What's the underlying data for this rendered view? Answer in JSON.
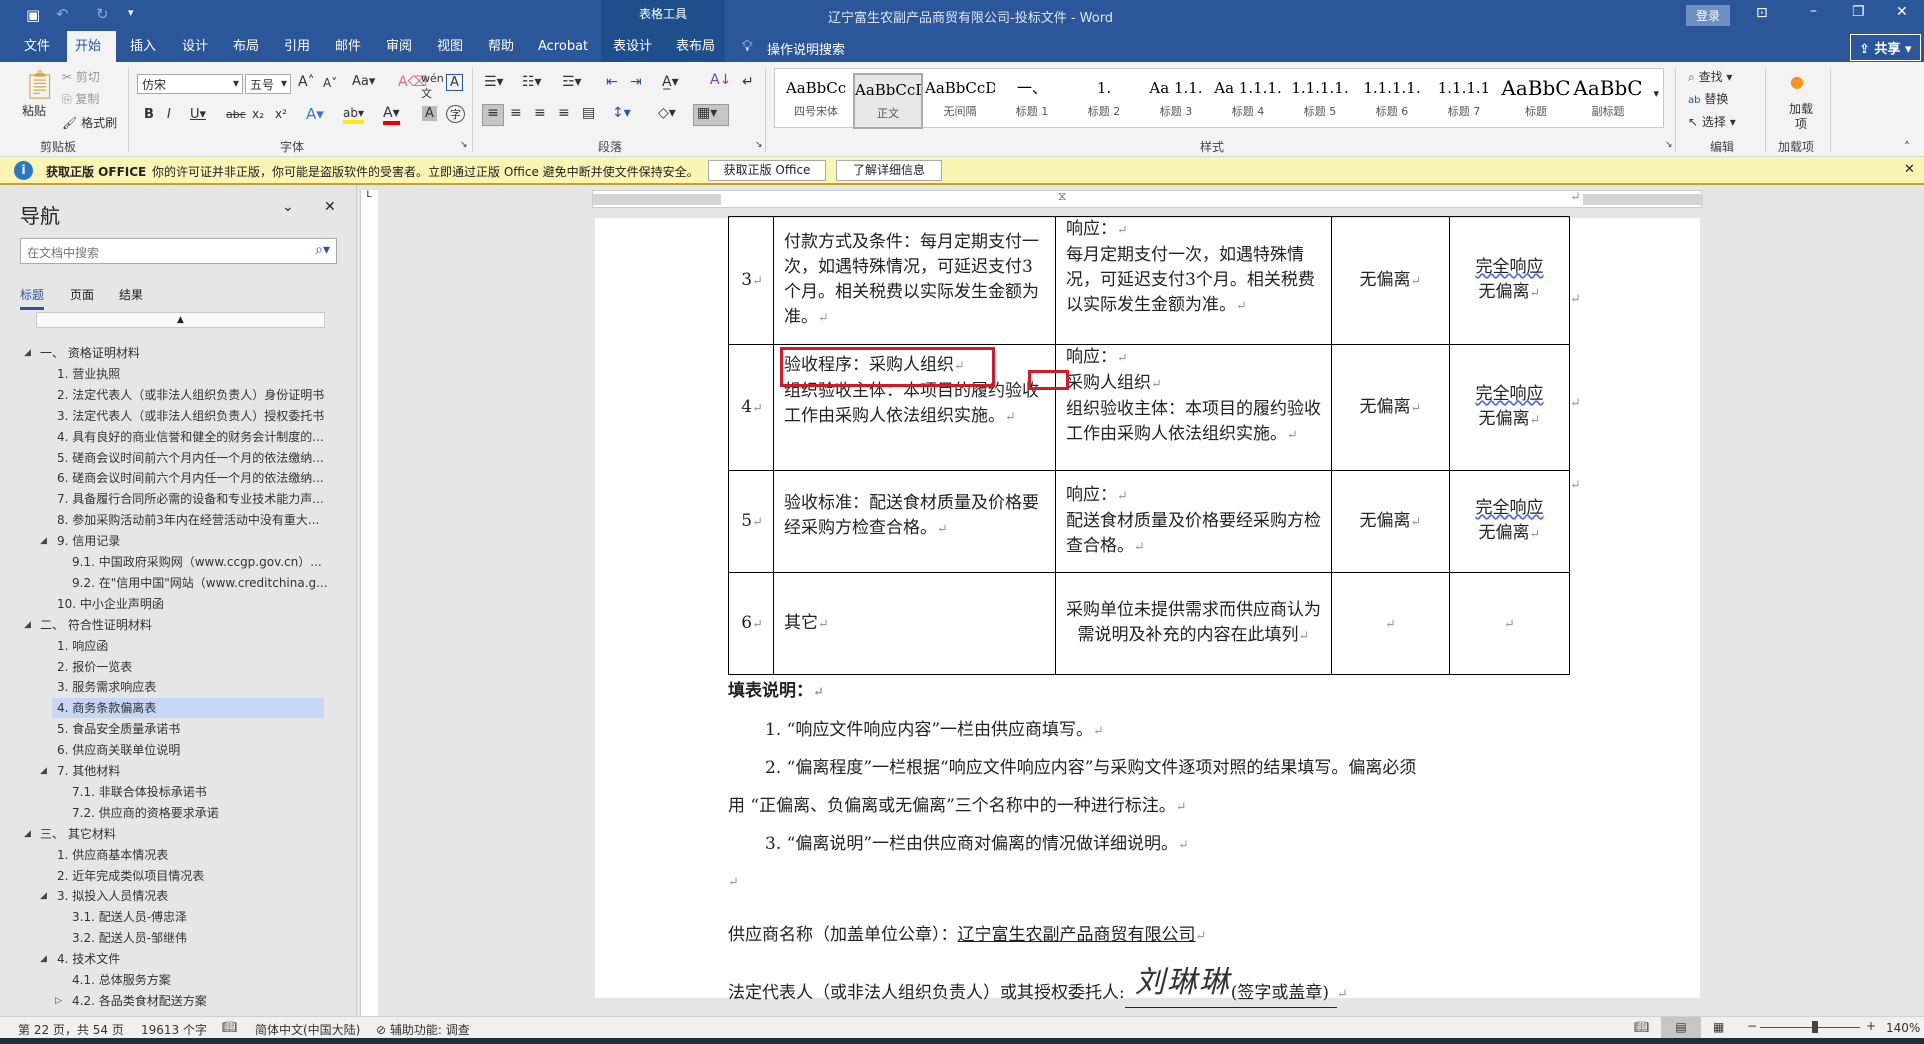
{
  "title_bar": {
    "document_title": "辽宁富生农副产品商贸有限公司-投标文件 - Word",
    "context_tab_group": "表格工具",
    "signin": "登录",
    "share": "共享"
  },
  "tabs": [
    "文件",
    "开始",
    "插入",
    "设计",
    "布局",
    "引用",
    "邮件",
    "审阅",
    "视图",
    "帮助",
    "Acrobat",
    "表设计",
    "表布局"
  ],
  "tell_me": "操作说明搜索",
  "ribbon": {
    "clipboard": {
      "paste": "粘贴",
      "cut": "剪切",
      "copy": "复制",
      "format_painter": "格式刷",
      "label": "剪贴板"
    },
    "font": {
      "font_name": "仿宋",
      "font_size": "五号",
      "label": "字体"
    },
    "paragraph": {
      "label": "段落"
    },
    "styles": {
      "label": "样式",
      "items": [
        {
          "preview": "AaBbCc",
          "name": "四号宋体"
        },
        {
          "preview": "AaBbCcDdI",
          "name": "正文"
        },
        {
          "preview": "AaBbCcDdI",
          "name": "无间隔"
        },
        {
          "preview": "一、",
          "name": "标题 1"
        },
        {
          "preview": "1.",
          "name": "标题 2"
        },
        {
          "preview": "Aa 1.1.",
          "name": "标题 3"
        },
        {
          "preview": "Aa 1.1.1.",
          "name": "标题 4"
        },
        {
          "preview": "1.1.1.1.",
          "name": "标题 5"
        },
        {
          "preview": "1.1.1.1.",
          "name": "标题 6"
        },
        {
          "preview": "1.1.1.1",
          "name": "标题 7"
        },
        {
          "preview": "AaBbC",
          "name": "标题"
        },
        {
          "preview": "AaBbC",
          "name": "副标题"
        }
      ]
    },
    "editing": {
      "find": "查找",
      "replace": "替换",
      "select": "选择",
      "label": "编辑"
    },
    "addins": {
      "button": "加载项",
      "label": "加载项"
    }
  },
  "notice": {
    "title": "获取正版 OFFICE",
    "message": "你的许可证并非正版，你可能是盗版软件的受害者。立即通过正版 Office 避免中断并使文件保持安全。",
    "btn_get": "获取正版 Office",
    "btn_learn": "了解详细信息"
  },
  "nav": {
    "title": "导航",
    "search_placeholder": "在文档中搜索",
    "tabs": [
      "标题",
      "页面",
      "结果"
    ],
    "items": [
      {
        "t": "一、  资格证明材料",
        "l": 0,
        "e": "open"
      },
      {
        "t": "1. 营业执照",
        "l": 1
      },
      {
        "t": "2. 法定代表人（或非法人组织负责人）身份证明书",
        "l": 1
      },
      {
        "t": "3. 法定代表人（或非法人组织负责人）授权委托书",
        "l": 1
      },
      {
        "t": "4. 具有良好的商业信誉和健全的财务会计制度的...",
        "l": 1
      },
      {
        "t": "5. 磋商会议时间前六个月内任一个月的依法缴纳...",
        "l": 1
      },
      {
        "t": "6. 磋商会议时间前六个月内任一个月的依法缴纳...",
        "l": 1
      },
      {
        "t": "7. 具备履行合同所必需的设备和专业技术能力声...",
        "l": 1
      },
      {
        "t": "8. 参加采购活动前3年内在经营活动中没有重大...",
        "l": 1
      },
      {
        "t": "9. 信用记录",
        "l": 1,
        "e": "open"
      },
      {
        "t": "9.1. 中国政府采购网（www.ccgp.gov.cn）...",
        "l": 2
      },
      {
        "t": "9.2. 在\"信用中国\"网站（www.creditchina.g...",
        "l": 2
      },
      {
        "t": "10. 中小企业声明函",
        "l": 1
      },
      {
        "t": "二、  符合性证明材料",
        "l": 0,
        "e": "open"
      },
      {
        "t": "1. 响应函",
        "l": 1
      },
      {
        "t": "2. 报价一览表",
        "l": 1
      },
      {
        "t": "3. 服务需求响应表",
        "l": 1
      },
      {
        "t": "4. 商务条款偏离表",
        "l": 1,
        "sel": true
      },
      {
        "t": "5. 食品安全质量承诺书",
        "l": 1
      },
      {
        "t": "6. 供应商关联单位说明",
        "l": 1
      },
      {
        "t": "7. 其他材料",
        "l": 1,
        "e": "open"
      },
      {
        "t": "7.1. 非联合体投标承诺书",
        "l": 2
      },
      {
        "t": "7.2. 供应商的资格要求承诺",
        "l": 2
      },
      {
        "t": "三、  其它材料",
        "l": 0,
        "e": "open"
      },
      {
        "t": "1. 供应商基本情况表",
        "l": 1
      },
      {
        "t": "2. 近年完成类似项目情况表",
        "l": 1
      },
      {
        "t": "3. 拟投入人员情况表",
        "l": 1,
        "e": "open"
      },
      {
        "t": "3.1. 配送人员-傅忠泽",
        "l": 2
      },
      {
        "t": "3.2. 配送人员-邹继伟",
        "l": 2
      },
      {
        "t": "4. 技术文件",
        "l": 1,
        "e": "open"
      },
      {
        "t": "4.1. 总体服务方案",
        "l": 2
      },
      {
        "t": "4.2. 各品类食材配送方案",
        "l": 2,
        "e": "closed"
      }
    ]
  },
  "table": {
    "rows": [
      {
        "no": "3",
        "req": "付款方式及条件：每月定期支付一次，如遇特殊情况，可延迟支付3个月。相关税费以实际发生金额为准。",
        "resp_head": "响应：",
        "resp": "每月定期支付一次，如遇特殊情况，可延迟支付3个月。相关税费以实际发生金额为准。",
        "dev": "无偏离",
        "note1": "完全响应",
        "note2": "无偏离"
      },
      {
        "no": "4",
        "req_head": "验收程序：采购人组织",
        "req": "组织验收主体：本项目的履约验收工作由采购人依法组织实施。",
        "resp_head": "响应：",
        "resp_sub": "采购人组织",
        "resp": "组织验收主体：本项目的履约验收工作由采购人依法组织实施。",
        "dev": "无偏离",
        "note1": "完全响应",
        "note2": "无偏离"
      },
      {
        "no": "5",
        "req": "验收标准：配送食材质量及价格要经采购方检查合格。",
        "resp_head": "响应：",
        "resp": "配送食材质量及价格要经采购方检查合格。",
        "dev": "无偏离",
        "note1": "完全响应",
        "note2": "无偏离"
      },
      {
        "no": "6",
        "req": "其它",
        "resp": "采购单位未提供需求而供应商认为需说明及补充的内容在此填列"
      }
    ]
  },
  "instructions": {
    "title": "填表说明：",
    "items": [
      "1. “响应文件响应内容”一栏由供应商填写。",
      "2. “偏离程度”一栏根据“响应文件响应内容”与采购文件逐项对照的结果填写。偏离必须",
      "用 “正偏离、负偏离或无偏离”三个名称中的一种进行标注。",
      "3. “偏离说明”一栏由供应商对偏离的情况做详细说明。"
    ]
  },
  "signature": {
    "supplier_label": "供应商名称（加盖单位公章）：",
    "supplier_name": "辽宁富生农副产品商贸有限公司",
    "rep_label": "法定代表人（或非法人组织负责人）或其授权委托人:",
    "handwritten": "刘琳琳",
    "sign_note": "(签字或盖章)"
  },
  "status": {
    "page": "第 22 页，共 54 页",
    "words": "19613 个字",
    "language": "简体中文(中国大陆)",
    "accessibility": "辅助功能: 调查",
    "zoom": "140%",
    "zoom_fraction": 0.55
  },
  "colors": {
    "brand": "#2b579a",
    "highlight": "#d01c24",
    "nav_selected": "#c5d7f2"
  }
}
